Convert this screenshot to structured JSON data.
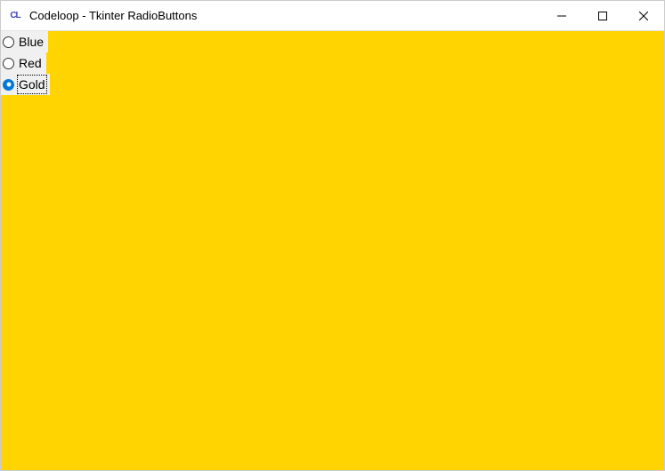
{
  "window": {
    "title": "Codeloop - Tkinter RadioButtons",
    "app_icon_text": "CL"
  },
  "background_color": "#ffd400",
  "radios": {
    "items": [
      {
        "label": "Blue",
        "selected": false,
        "focused": false
      },
      {
        "label": "Red",
        "selected": false,
        "focused": false
      },
      {
        "label": "Gold",
        "selected": true,
        "focused": true
      }
    ]
  }
}
